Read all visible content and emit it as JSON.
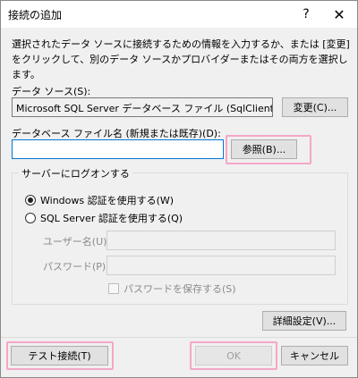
{
  "window": {
    "title": "接続の追加",
    "help_glyph": "?",
    "close_glyph": "✕"
  },
  "description": "選択されたデータ ソースに接続するための情報を入力するか、または [変更] をクリックして、別のデータ ソースかプロバイダーまたはその両方を選択します。",
  "data_source": {
    "label": "データ ソース(S):",
    "value": "Microsoft SQL Server データベース ファイル (SqlClient)",
    "change_button": "変更(C)..."
  },
  "db_file": {
    "label": "データベース ファイル名 (新規または既存)(D):",
    "value": "",
    "browse_button": "参照(B)..."
  },
  "logon": {
    "group_title": "サーバーにログオンする",
    "windows_auth": "Windows 認証を使用する(W)",
    "sql_auth": "SQL Server 認証を使用する(Q)",
    "selected": "windows",
    "username_label": "ユーザー名(U):",
    "password_label": "パスワード(P):",
    "save_password": "パスワードを保存する(S)"
  },
  "buttons": {
    "advanced": "詳細設定(V)...",
    "test_connection": "テスト接続(T)",
    "ok": "OK",
    "cancel": "キャンセル"
  },
  "colors": {
    "highlight": "#f4a7c8",
    "focus_border": "#0078d7"
  }
}
